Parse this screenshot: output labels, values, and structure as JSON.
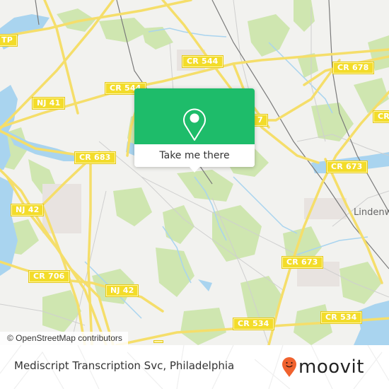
{
  "map": {
    "colors": {
      "background": "#f2f2ef",
      "park": "#cfe6b0",
      "water": "#a9d4ef",
      "major_road": "#f5de6a",
      "minor_road": "#c8c8c8",
      "rail": "#777777",
      "shield": "#f3dc2a"
    },
    "road_labels": [
      {
        "id": "tp",
        "text": "TP"
      },
      {
        "id": "cr544-top",
        "text": "CR 544"
      },
      {
        "id": "cr544-mid",
        "text": "CR 544"
      },
      {
        "id": "cr678",
        "text": "CR 678"
      },
      {
        "id": "nj41",
        "text": "NJ 41"
      },
      {
        "id": "cr577",
        "text": "7"
      },
      {
        "id": "cr683",
        "text": "CR 683"
      },
      {
        "id": "cr673-right",
        "text": "CR 673"
      },
      {
        "id": "cr-right-edge",
        "text": "CR"
      },
      {
        "id": "nj42-left",
        "text": "NJ 42"
      },
      {
        "id": "cr673-lower",
        "text": "CR 673"
      },
      {
        "id": "cr706",
        "text": "CR 706"
      },
      {
        "id": "nj42-lower",
        "text": "NJ 42"
      },
      {
        "id": "cr534-left",
        "text": "CR 534"
      },
      {
        "id": "cr534-right",
        "text": "CR 534"
      }
    ],
    "place_labels": [
      {
        "id": "lindenwold",
        "text": "Lindenw"
      }
    ],
    "attribution": "© OpenStreetMap contributors"
  },
  "popup": {
    "icon": "location-pin-icon",
    "button_label": "Take me there",
    "accent_color": "#1ebc6a"
  },
  "footer": {
    "title": "Mediscript Transcription Svc, Philadelphia",
    "logo_text": "moovit",
    "logo_color": "#f0622e"
  }
}
